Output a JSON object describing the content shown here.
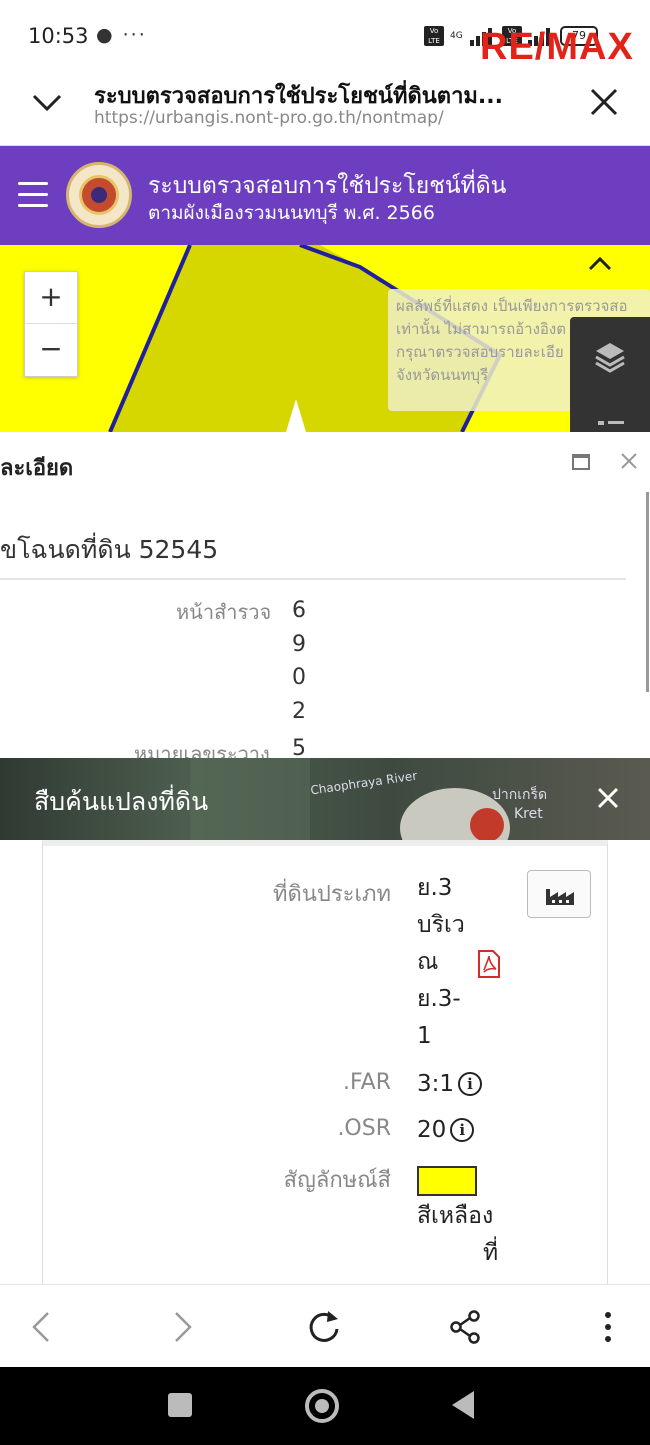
{
  "status": {
    "time": "10:53",
    "notif_icons": "● ···",
    "network": "4G",
    "battery": "79",
    "watermark_left": "RE",
    "watermark_slash": "/",
    "watermark_right": "MAX"
  },
  "tab": {
    "title": "ระบบตรวจสอบการใช้ประโยชน์ที่ดินตาม...",
    "url": "https://urbangis.nont-pro.go.th/nontmap/"
  },
  "app": {
    "title_line1": "ระบบตรวจสอบการใช้ประโยชน์ที่ดิน",
    "title_line2": "ตามผังเมืองรวมนนทบุรี พ.ศ. 2566"
  },
  "map": {
    "zoom_in": "+",
    "zoom_out": "−",
    "disclaimer_lines": [
      "ผลลัพธ์ที่แสดง เป็นเพียงการตรวจสอ",
      "เท่านั้น ไม่สามารถอ้างอิงต",
      "กรุณาตรวจสอบรายละเอีย",
      "จังหวัดนนทบุรี"
    ],
    "colors": {
      "zone": "#ffff00",
      "boundary": "#1f1fa0",
      "header": "#6d3fc0"
    }
  },
  "detail": {
    "title": "ละเอียด",
    "deed": "ขโฉนดที่ดิน 52545",
    "survey_label": "หน้าสำรวจ",
    "survey_digits": [
      "6",
      "9",
      "0",
      "2"
    ],
    "cut_label": "หมายเลขระวาง",
    "cut_value": "5"
  },
  "search": {
    "title": "สืบค้นแปลงที่ดิน",
    "map_label_river": "Chaophraya River",
    "map_label_place": "ปากเกร็ด",
    "map_label_kret": "Kret"
  },
  "land": {
    "type_label": "ที่ดินประเภท",
    "type_value_lines": [
      "ย.3",
      "บริเว",
      "ณ",
      "ย.3-",
      "1"
    ],
    "far_label": ".FAR",
    "far_value": "3:1",
    "osr_label": ".OSR",
    "osr_value": "20",
    "info_glyph": "i",
    "color_label": "สัญลักษณ์สี",
    "color_value_lines": [
      "สีเหลือง",
      "ที่"
    ],
    "swatch_color": "#ffff00"
  }
}
